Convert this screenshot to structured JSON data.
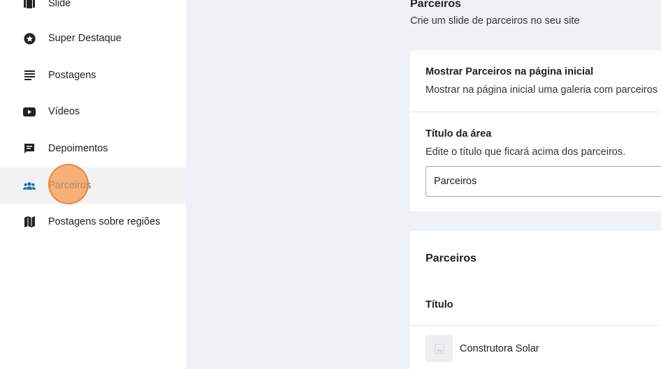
{
  "sidebar": {
    "items": [
      {
        "label": "Slide",
        "icon": "slide-icon",
        "active": false
      },
      {
        "label": "Super Destaque",
        "icon": "star-circle-icon",
        "active": false
      },
      {
        "label": "Postagens",
        "icon": "text-lines-icon",
        "active": false
      },
      {
        "label": "Vídeos",
        "icon": "youtube-icon",
        "active": false
      },
      {
        "label": "Depoimentos",
        "icon": "chat-icon",
        "active": false
      },
      {
        "label": "Parceiros",
        "icon": "users-icon",
        "active": true
      },
      {
        "label": "Postagens sobre regiões",
        "icon": "map-icon",
        "active": false
      }
    ]
  },
  "header": {
    "title": "Parceiros",
    "subtitle": "Crie um slide de parceiros no seu site"
  },
  "settings": {
    "show_title": "Mostrar Parceiros na página inicial",
    "show_desc": "Mostrar na página inicial uma galeria com parceiros",
    "area_title": "Título da área",
    "area_desc": "Edite o título que ficará acima dos parceiros.",
    "area_value": "Parceiros"
  },
  "partners": {
    "section_title": "Parceiros",
    "column_header": "Título",
    "rows": [
      {
        "name": "Construtora Solar"
      }
    ]
  },
  "colors": {
    "accent": "#1f6fb2",
    "background": "#eef1f6",
    "active_item_bg": "#f2f2f2"
  }
}
